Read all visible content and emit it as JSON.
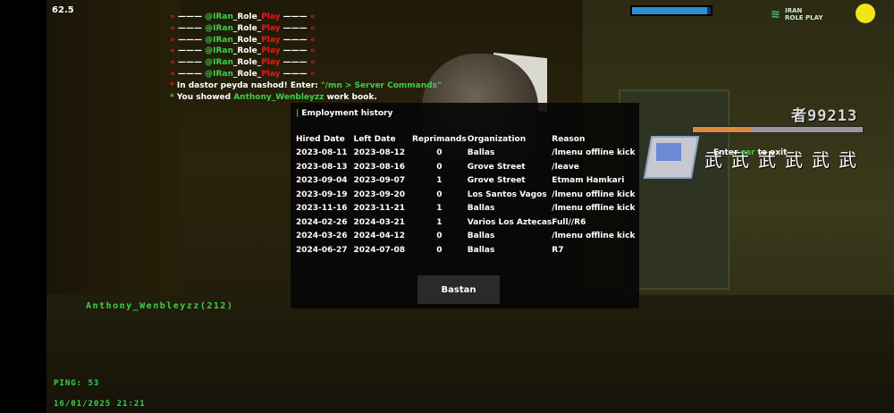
{
  "hud": {
    "fps": "62.5",
    "health_percent": 95,
    "logo_mark": "≋",
    "logo_line1": "IRAN",
    "logo_line2": "ROLE PLAY",
    "money": "者99213",
    "money_bar_percent": 34,
    "enter_hint_prefix": "Enter",
    "enter_hint_key": " car ",
    "enter_hint_suffix": "to exit",
    "wanted_glyphs": "武武武武武武",
    "player_name": "Anthony_Wenbleyzz(212)",
    "ping": "PING: 53",
    "datetime": "16/01/2025 21:21"
  },
  "chat": {
    "banner": {
      "left_arrow": "»",
      "dashes": " ——— ",
      "at_name": "@IRan",
      "mid": "_Role_",
      "play": "Play",
      "right_arrow": "«",
      "count": 6
    },
    "line1_star": "*",
    "line1_text": " In dastor peyda nashod! Enter: ",
    "line1_cmd": "\"/mn > Server Commands\"",
    "line2_star": "*",
    "line2_text": " You showed ",
    "line2_name": "Anthony_Wenbleyzz",
    "line2_end": " work book."
  },
  "dialog": {
    "title_bar": "|",
    "title": "Employment history",
    "columns": [
      "Hired Date",
      "Left Date",
      "Reprimands",
      "Organization",
      "Reason"
    ],
    "rows": [
      [
        "2023-08-11",
        "2023-08-12",
        "0",
        "Ballas",
        "/lmenu offline kick"
      ],
      [
        "2023-08-13",
        "2023-08-16",
        "0",
        "Grove Street",
        "/leave"
      ],
      [
        "2023-09-04",
        "2023-09-07",
        "1",
        "Grove Street",
        "Etmam Hamkari"
      ],
      [
        "2023-09-19",
        "2023-09-20",
        "0",
        "Los Santos Vagos",
        "/lmenu offline kick"
      ],
      [
        "2023-11-16",
        "2023-11-21",
        "1",
        "Ballas",
        "/lmenu offline kick"
      ],
      [
        "2024-02-26",
        "2024-03-21",
        "1",
        "Varios Los Aztecas",
        "Full//R6"
      ],
      [
        "2024-03-26",
        "2024-04-12",
        "0",
        "Ballas",
        "/lmenu offline kick"
      ],
      [
        "2024-06-27",
        "2024-07-08",
        "0",
        "Ballas",
        "R7"
      ]
    ],
    "close_label": "Bastan"
  }
}
